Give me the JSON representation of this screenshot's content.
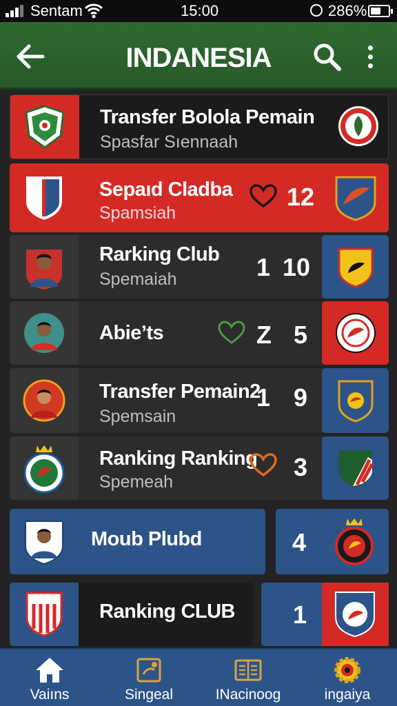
{
  "status_bar": {
    "carrier": "Sentam",
    "time": "15:00",
    "battery": "286%"
  },
  "header": {
    "title": "INDANESIA"
  },
  "rows": [
    {
      "title": "Transfer Bolola Pemain",
      "subtitle": "Spasfar Sıennaah"
    },
    {
      "title": "Sepaıd Cladba",
      "subtitle": "Spamsiah",
      "score": "12"
    },
    {
      "title": "Rarking Club",
      "subtitle": "Spemaiah",
      "num_left": "1",
      "num_right": "10"
    },
    {
      "title": "Abieʼts",
      "num_left": "Z",
      "num_right": "5"
    },
    {
      "title": "Transfer Pemain2",
      "subtitle": "Spemsain",
      "num_left": "1",
      "num_right": "9"
    },
    {
      "title": "Ranking Ranking",
      "subtitle": "Spemeah",
      "num_right": "3"
    },
    {
      "title": "Moub Plubd",
      "num": "4"
    },
    {
      "title": "Ranking CLUB",
      "num": "1"
    }
  ],
  "bottom_nav": [
    {
      "label": "Vaiıns",
      "icon": "home-icon"
    },
    {
      "label": "Singeal",
      "icon": "ticket-icon"
    },
    {
      "label": "INacinoog",
      "icon": "newspaper-icon"
    },
    {
      "label": "ingaiya",
      "icon": "gear-icon"
    }
  ],
  "colors": {
    "header_green": "#2f6b2f",
    "highlight_red": "#d42a26",
    "tile_blue": "#2d5488",
    "row_dark": "#1b1b1b",
    "row_grey": "#2c2c2c"
  }
}
